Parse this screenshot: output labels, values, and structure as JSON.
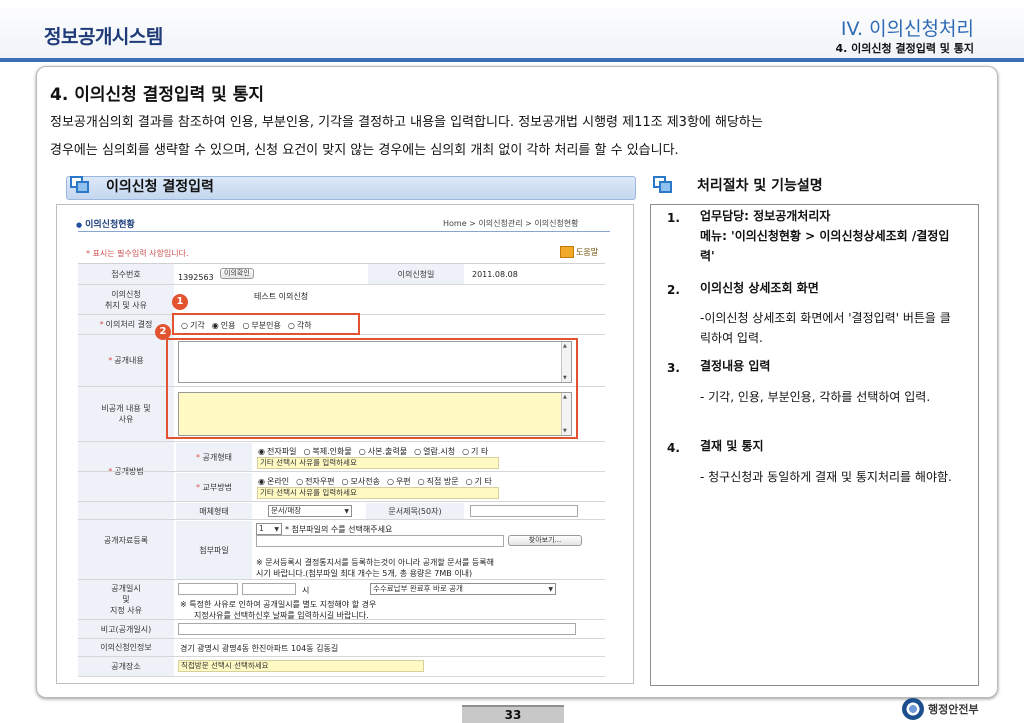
{
  "header": {
    "app_title": "정보공개시스템",
    "section_title": "IV. 이의신청처리",
    "section_sub": "4. 이의신청 결정입력 및 통지"
  },
  "main": {
    "heading": "4. 이의신청 결정입력 및 통지",
    "desc_line1": "정보공개심의회 결과를 참조하여 인용, 부분인용, 기각을 결정하고 내용을 입력합니다. 정보공개법 시행령 제11조 제3항에 해당하는",
    "desc_line2": "경우에는 심의회를 생략할 수 있으며, 신청 요건이 맞지 않는 경우에는 심의회 개최 없이 각하 처리를 할 수 있습니다."
  },
  "left_panel": {
    "title": "이의신청 결정입력"
  },
  "form": {
    "crumb_title": "이의신청현황",
    "crumb_path": "Home > 이의신청관리 > 이의신청현황",
    "required_note": "* 표시는 필수입력 사항입니다.",
    "help_label": "도움말",
    "receipt_no_label": "접수번호",
    "receipt_no": "1392563",
    "confirm_btn": "이의확인",
    "appeal_date_label": "이의신청일",
    "appeal_date": "2011.08.08",
    "reason_label": "이의신청\n취지 및 사유",
    "reason_value": "테스트 이의신청",
    "result_label": "이의처리 결정",
    "result_options": [
      "기각",
      "인용",
      "부분인용",
      "각하"
    ],
    "result_selected": 1,
    "disclosure_content_label": "공개내용",
    "nondisclosure_label": "비공개 내용 및\n사유",
    "method_label": "공개방법",
    "form_type_label": "공개형태",
    "form_type_options": [
      "전자파일",
      "복제.인화물",
      "사본.출력물",
      "열람.시청",
      "기 타"
    ],
    "form_type_selected": 0,
    "etc_placeholder": "기타 선택시 사유를 입력하세요",
    "delivery_label": "교부방법",
    "delivery_options": [
      "온라인",
      "전자우편",
      "모사전송",
      "우편",
      "직접 방문",
      "기 타"
    ],
    "delivery_selected": 0,
    "delivery_etc_placeholder": "기타 선택시 사유를 입력하세요",
    "material_reg_label": "공개자료등록",
    "medium_label": "매체형태",
    "medium_value": "문서/매장",
    "doc_title_label": "문서제목(50자)",
    "attach_label": "첨부파일",
    "attach_count": "1",
    "attach_hint": "* 첨부파일의 수를 선택해주세요",
    "browse_btn": "찾아보기...",
    "attach_note1": "※ 문서등록시 결정통지서를 등록하는것이 아니라 공개할 문서를 등록해",
    "attach_note2": "시기 바랍니다.(첨부파일 최대 개수는 5개, 총 용량은 7MB 이내)",
    "schedule_label": "공개일시\n및\n지정 사유",
    "hour_label": "시",
    "schedule_select": "수수료납부 완료후 바로 공개",
    "schedule_note1": "※ 특정한 사유로 인하여 공개일시를 별도 지정해야 할 경우",
    "schedule_note2": "지정사유를 선택하신후 날짜를 입력하시길 바랍니다.",
    "remark_label": "비고(공개일시)",
    "applicant_label": "이의신청인정보",
    "applicant_value": "경기 광명시 광명4동 한진아파트 104동 김동길",
    "place_label": "공개장소",
    "place_placeholder": "직접방문 선택시 선택하세요"
  },
  "badges": [
    "1",
    "2"
  ],
  "right_panel": {
    "title": "처리절차 및 기능설명",
    "steps": [
      {
        "num": "1.",
        "title": "업무담당: 정보공개처리자\n메뉴: '이의신청현황 > 이의신청상세조회 /결정입력'",
        "body": ""
      },
      {
        "num": "2.",
        "title": "이의신청 상세조회 화면",
        "body": "-이의신청 상세조회 화면에서  '결정입력' 버튼을 클릭하여 입력."
      },
      {
        "num": "3.",
        "title": "결정내용 입력",
        "body": "- 기각, 인용, 부분인용, 각하를 선택하여 입력."
      },
      {
        "num": "4.",
        "title": "결재 및 통지",
        "body": "- 청구신청과 동일하게 결재 및 통지처리를 해야함."
      }
    ]
  },
  "footer": {
    "page_number": "33",
    "ministry": "행정안전부"
  }
}
